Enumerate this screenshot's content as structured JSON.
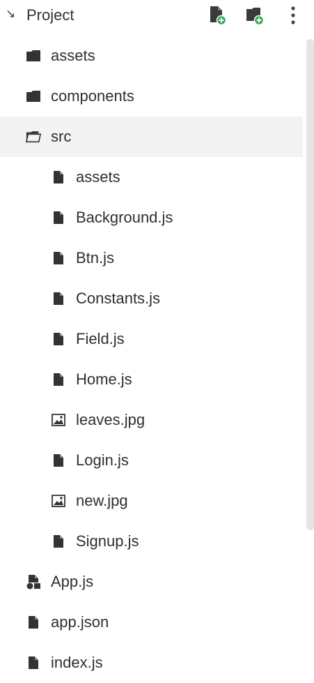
{
  "header": {
    "title": "Project",
    "icons": [
      "collapse-arrow-icon",
      "new-file-icon",
      "new-folder-icon",
      "more-vertical-icon"
    ],
    "accent_color": "#34a853"
  },
  "tree": {
    "items": [
      {
        "label": "assets",
        "icon": "folder-icon",
        "level": 0
      },
      {
        "label": "components",
        "icon": "folder-icon",
        "level": 0
      },
      {
        "label": "src",
        "icon": "folder-open-icon",
        "level": 0,
        "selected": true
      },
      {
        "label": "assets",
        "icon": "file-icon",
        "level": 1
      },
      {
        "label": "Background.js",
        "icon": "file-icon",
        "level": 1
      },
      {
        "label": "Btn.js",
        "icon": "file-icon",
        "level": 1
      },
      {
        "label": "Constants.js",
        "icon": "file-icon",
        "level": 1
      },
      {
        "label": "Field.js",
        "icon": "file-icon",
        "level": 1
      },
      {
        "label": "Home.js",
        "icon": "file-icon",
        "level": 1
      },
      {
        "label": "leaves.jpg",
        "icon": "image-icon",
        "level": 1
      },
      {
        "label": "Login.js",
        "icon": "file-icon",
        "level": 1
      },
      {
        "label": "new.jpg",
        "icon": "image-icon",
        "level": 1
      },
      {
        "label": "Signup.js",
        "icon": "file-icon",
        "level": 1
      },
      {
        "label": "App.js",
        "icon": "app-file-icon",
        "level": 0
      },
      {
        "label": "app.json",
        "icon": "file-icon",
        "level": 0
      },
      {
        "label": "index.js",
        "icon": "file-icon",
        "level": 0
      }
    ]
  }
}
